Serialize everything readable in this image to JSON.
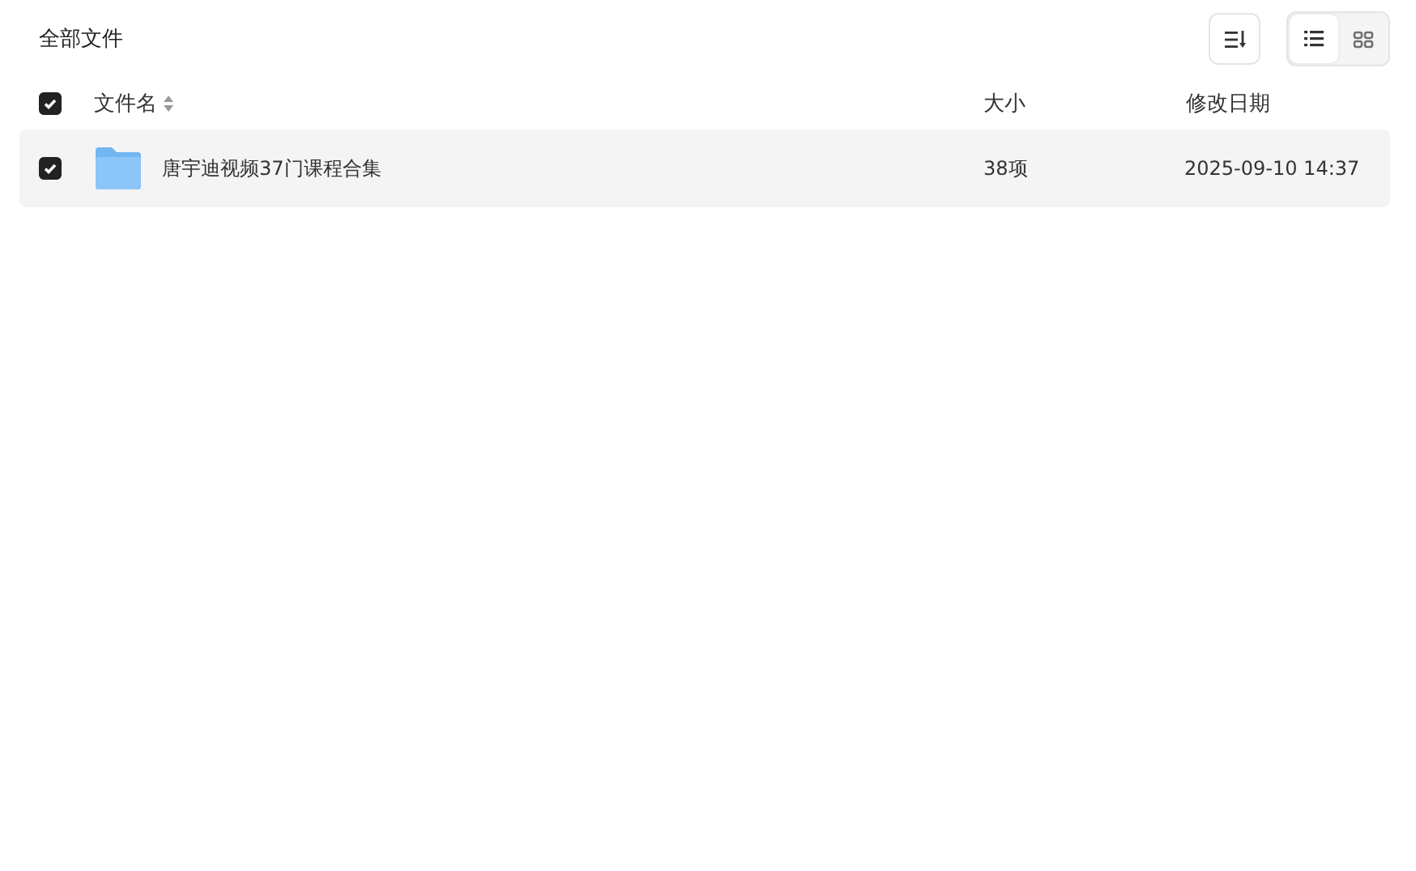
{
  "title": "全部文件",
  "view_modes": [
    {
      "kind": "list",
      "selected": true
    },
    {
      "kind": "grid",
      "selected": false
    }
  ],
  "table": {
    "select_all": {
      "checked": true
    },
    "columns": [
      {
        "kind": "sortable",
        "label": "文件名"
      },
      {
        "kind": "plain",
        "label": "大小"
      },
      {
        "kind": "plain",
        "label": "修改日期"
      }
    ],
    "rows": [
      {
        "checked": true,
        "kind": "folder",
        "name": "唐宇迪视频37门课程合集",
        "size": "38项",
        "modified": "2025-09-10 14:37"
      }
    ]
  }
}
